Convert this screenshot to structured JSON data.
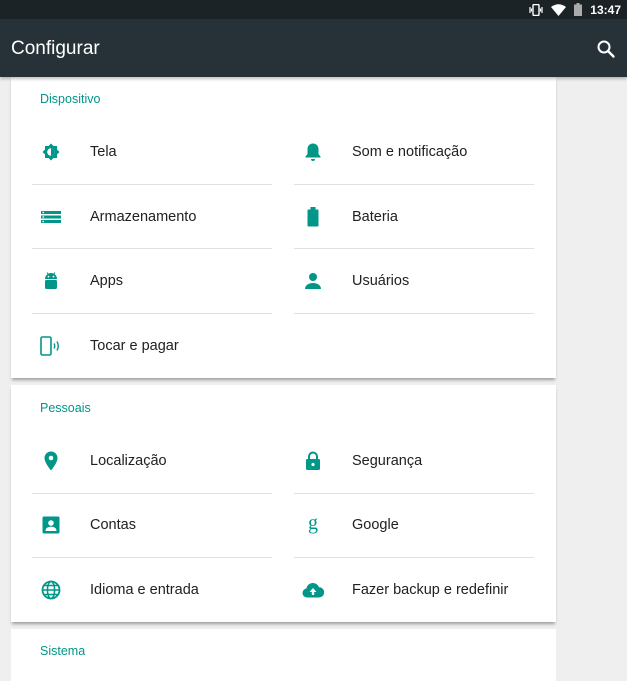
{
  "status_bar": {
    "time": "13:47",
    "icons": [
      "vibrate-icon",
      "wifi-icon",
      "battery-icon"
    ]
  },
  "app_bar": {
    "title": "Configurar",
    "search_icon": "search-icon"
  },
  "accent_color": "#009688",
  "sections": {
    "device": {
      "title": "Dispositivo",
      "items": [
        {
          "label": "Tela",
          "icon": "brightness-icon"
        },
        {
          "label": "Som e notificação",
          "icon": "bell-icon"
        },
        {
          "label": "Armazenamento",
          "icon": "storage-icon"
        },
        {
          "label": "Bateria",
          "icon": "battery-icon"
        },
        {
          "label": "Apps",
          "icon": "android-icon"
        },
        {
          "label": "Usuários",
          "icon": "person-icon"
        },
        {
          "label": "Tocar e pagar",
          "icon": "tap-pay-icon"
        }
      ]
    },
    "personal": {
      "title": "Pessoais",
      "items": [
        {
          "label": "Localização",
          "icon": "location-icon"
        },
        {
          "label": "Segurança",
          "icon": "lock-icon"
        },
        {
          "label": "Contas",
          "icon": "account-box-icon"
        },
        {
          "label": "Google",
          "icon": "google-icon"
        },
        {
          "label": "Idioma e entrada",
          "icon": "globe-icon"
        },
        {
          "label": "Fazer backup e redefinir",
          "icon": "cloud-upload-icon"
        }
      ]
    },
    "system": {
      "title": "Sistema"
    }
  }
}
